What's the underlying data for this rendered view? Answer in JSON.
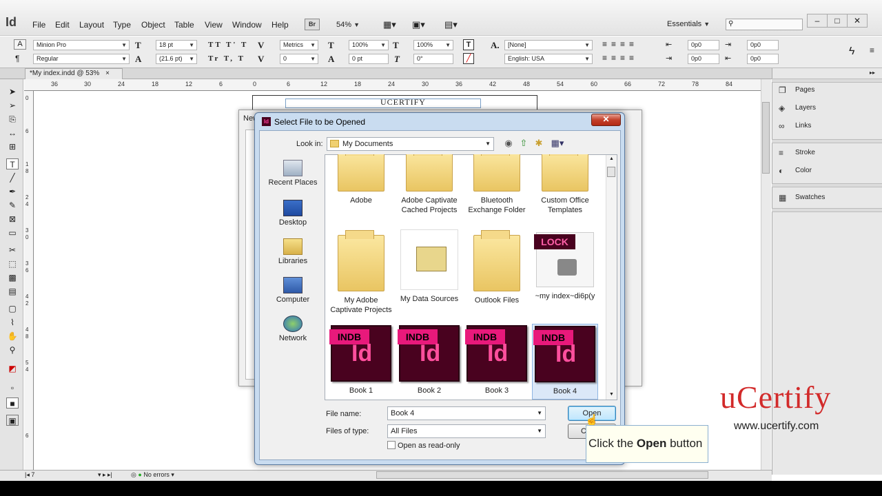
{
  "app": {
    "logo": "Id",
    "menus": [
      "File",
      "Edit",
      "Layout",
      "Type",
      "Object",
      "Table",
      "View",
      "Window",
      "Help"
    ],
    "bridge_label": "Br",
    "zoom": "54%",
    "workspace": "Essentials",
    "window_controls": [
      "–",
      "□",
      "✕"
    ]
  },
  "control_panel": {
    "font_family": "Minion Pro",
    "font_style": "Regular",
    "font_size": "18 pt",
    "leading": "(21.6 pt)",
    "kerning": "Metrics",
    "tracking": "0",
    "vscale": "100%",
    "hscale": "100%",
    "baseline": "0 pt",
    "skew": "0°",
    "char_style": "[None]",
    "language": "English: USA",
    "indent1": "0p0",
    "indent2": "0p0",
    "indent3": "0p0",
    "indent4": "0p0"
  },
  "document_tab": {
    "label": "*My index.indd @ 53%",
    "close": "×"
  },
  "ruler": {
    "h_labels": [
      "36",
      "30",
      "24",
      "18",
      "12",
      "6",
      "0",
      "6",
      "12",
      "18",
      "24",
      "30",
      "36",
      "42",
      "48",
      "54",
      "60",
      "66",
      "72",
      "78",
      "84"
    ],
    "v_labels": [
      "0",
      "6",
      "1",
      "8",
      "2",
      "4",
      "3",
      "0",
      "3",
      "6",
      "4",
      "2",
      "4",
      "8",
      "5",
      "4",
      "6"
    ]
  },
  "canvas": {
    "page_title": "UCERTIFY"
  },
  "panels": {
    "group1": [
      "Pages",
      "Layers",
      "Links"
    ],
    "group2": [
      "Stroke",
      "Color"
    ],
    "group3": [
      "Swatches"
    ]
  },
  "status": {
    "page": "7",
    "preflight": "No errors"
  },
  "bg_dialog": {
    "title": "New"
  },
  "dialog": {
    "title": "Select File to be Opened",
    "close": "✕",
    "look_in_label": "Look in:",
    "look_in_value": "My Documents",
    "places": [
      "Recent Places",
      "Desktop",
      "Libraries",
      "Computer",
      "Network"
    ],
    "files_row1": [
      "Adobe",
      "Adobe Captivate Cached Projects",
      "Bluetooth Exchange Folder",
      "Custom Office Templates"
    ],
    "files_row2": [
      "My Adobe Captivate Projects",
      "My Data Sources",
      "Outlook Files",
      "~my index~di6p(y"
    ],
    "files_row3": [
      "Book 1",
      "Book 2",
      "Book 3",
      "Book 4"
    ],
    "indb_tag": "INDB",
    "lock_tag": "LOCK",
    "id_glyph": "Id",
    "file_name_label": "File name:",
    "file_name_value": "Book 4",
    "file_type_label": "Files of type:",
    "file_type_value": "All Files",
    "read_only_label": "Open as read-only",
    "open_button": "Open",
    "cancel_button": "C"
  },
  "tooltip": {
    "prefix": "Click the ",
    "bold": "Open",
    "suffix": " button"
  },
  "watermark": {
    "logo": "uCertify",
    "url": "www.ucertify.com"
  }
}
